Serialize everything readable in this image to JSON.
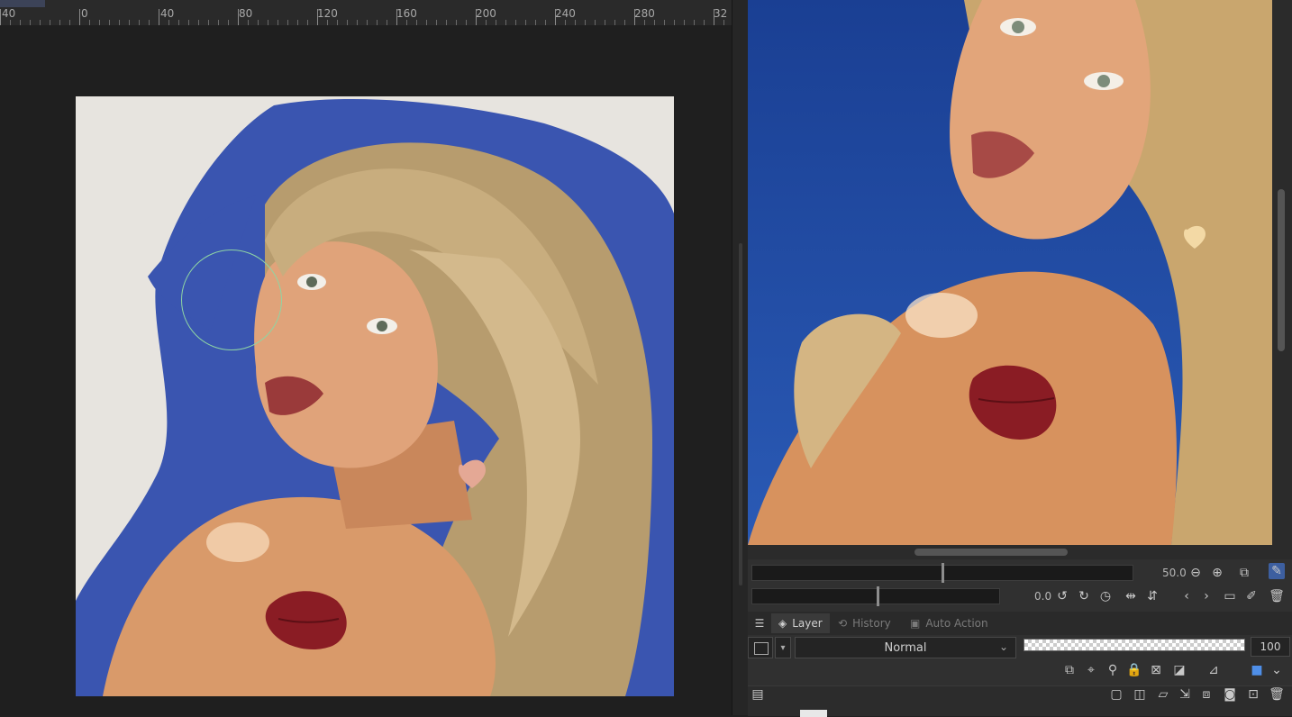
{
  "ruler": {
    "labels": [
      "40",
      "0",
      "40",
      "80",
      "120",
      "160",
      "200",
      "240",
      "280",
      "32"
    ]
  },
  "navigator": {
    "zoom_value": "50.0",
    "rotation_value": "0.0"
  },
  "layer_panel": {
    "tabs": [
      {
        "label": "Layer",
        "icon": "layers-icon"
      },
      {
        "label": "History",
        "icon": "history-icon"
      },
      {
        "label": "Auto Action",
        "icon": "auto-action-icon"
      }
    ],
    "blend_mode": "Normal",
    "opacity": "100"
  },
  "colors": {
    "canvas_bg": "#1f1f1f",
    "paper": "#e7e4df",
    "paint_blue": "#3a55b0",
    "hair": "#c2a87a",
    "skin": "#d99a6a",
    "lips": "#9a3a3a",
    "kiss_mark": "#8a1c24",
    "reference_sky": "#1f4a9e",
    "brush_cursor": "#8fd5a4"
  }
}
